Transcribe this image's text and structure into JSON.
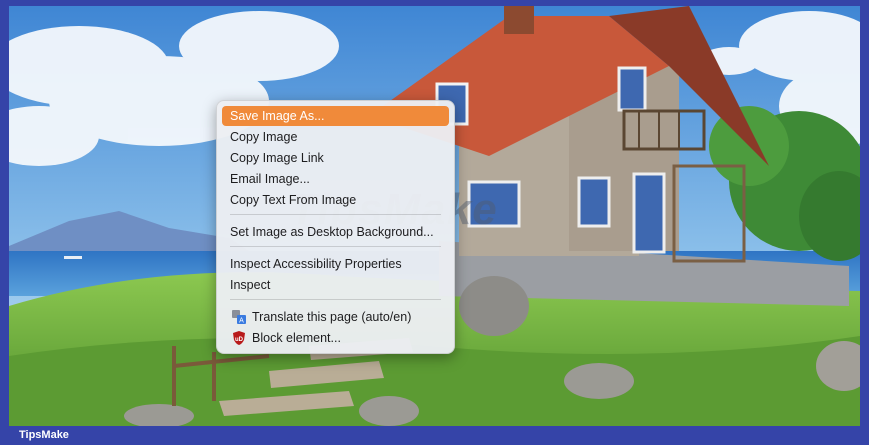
{
  "context_menu": {
    "items": [
      {
        "label": "Save Image As..."
      },
      {
        "label": "Copy Image"
      },
      {
        "label": "Copy Image Link"
      },
      {
        "label": "Email Image..."
      },
      {
        "label": "Copy Text From Image"
      },
      {
        "label": "Set Image as Desktop Background..."
      },
      {
        "label": "Inspect Accessibility Properties"
      },
      {
        "label": "Inspect"
      },
      {
        "label": "Translate this page (auto/en)",
        "icon": "translate-icon"
      },
      {
        "label": "Block element...",
        "icon": "ublock-shield-icon"
      }
    ],
    "highlight_color": "#f08a3a"
  },
  "watermark": "TipsMake",
  "footer": {
    "brand": "TipsMake"
  },
  "colors": {
    "frame": "#3544a8",
    "sky": "#4d8fd6",
    "grass": "#6aab3c",
    "roof": "#c8583a"
  }
}
